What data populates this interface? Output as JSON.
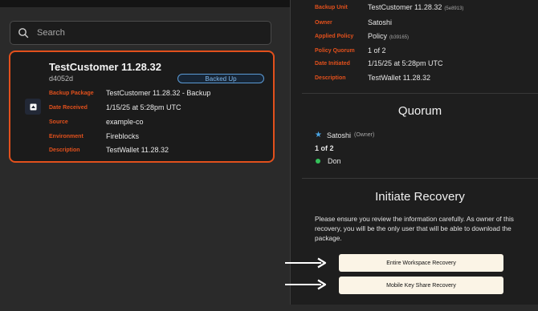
{
  "search": {
    "placeholder": "Search"
  },
  "card": {
    "title": "TestCustomer 11.28.32",
    "id": "d4052d",
    "status": "Backed Up",
    "fields": [
      {
        "label": "Backup Package",
        "value": "TestCustomer 11.28.32 - Backup"
      },
      {
        "label": "Date Received",
        "value": "1/15/25 at 5:28pm UTC"
      },
      {
        "label": "Source",
        "value": "example-co"
      },
      {
        "label": "Environment",
        "value": "Fireblocks"
      },
      {
        "label": "Description",
        "value": "TestWallet 11.28.32"
      }
    ]
  },
  "details": {
    "backup_unit": {
      "label": "Backup Unit",
      "value": "TestCustomer 11.28.32",
      "id": "(5e8913)"
    },
    "owner": {
      "label": "Owner",
      "value": "Satoshi"
    },
    "applied_policy": {
      "label": "Applied Policy",
      "value": "Policy",
      "id": "(b39165)"
    },
    "policy_quorum": {
      "label": "Policy Quorum",
      "value": "1 of 2"
    },
    "date_initiated": {
      "label": "Date Initiated",
      "value": "1/15/25 at 5:28pm UTC"
    },
    "description": {
      "label": "Description",
      "value": "TestWallet 11.28.32"
    }
  },
  "quorum": {
    "heading": "Quorum",
    "owner_name": "Satoshi",
    "owner_role": "(Owner)",
    "count": "1 of 2",
    "member": "Don"
  },
  "recovery": {
    "heading": "Initiate Recovery",
    "message": "Please ensure you review the information carefully. As owner of this recovery, you will be the only user that will be able to download the package.",
    "buttons": [
      "Entire Workspace Recovery",
      "Mobile Key Share Recovery"
    ]
  },
  "colors": {
    "accent": "#e2501c",
    "badge": "#7fb6ea",
    "star": "#4aa6e6",
    "online": "#34c15a",
    "button_bg": "#fbf4e6"
  }
}
